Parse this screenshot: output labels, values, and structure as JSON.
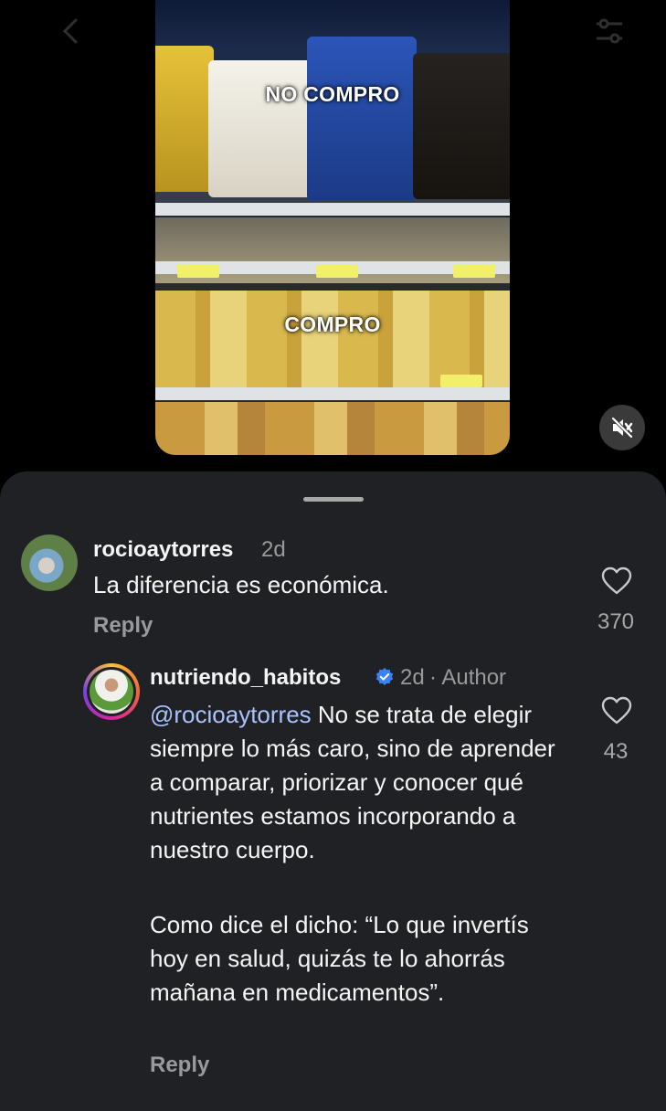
{
  "video": {
    "overlay_top": "NO COMPRO",
    "overlay_bottom": "COMPRO"
  },
  "comments": [
    {
      "username": "rocioaytorres",
      "time": "2d",
      "text": "La diferencia es económica.",
      "reply_label": "Reply",
      "likes": "370"
    },
    {
      "username": "nutriendo_habitos",
      "verified": true,
      "time": "2d",
      "author_tag": "· Author",
      "mention": "@rocioaytorres",
      "text_p1": " No se trata de elegir siempre lo más caro, sino de aprender a comparar, priorizar y conocer qué nutrientes estamos incorporando a nuestro cuerpo.",
      "text_p2": "Como dice el dicho: “Lo que invertís hoy en salud, quizás te lo ahorrás mañana en medicamentos”.",
      "reply_label": "Reply",
      "likes": "43"
    }
  ],
  "icons": {
    "back": "chevron-left-icon",
    "filter": "sliders-icon",
    "mute": "speaker-muted-icon",
    "like": "heart-outline-icon",
    "verified": "verified-badge-icon"
  },
  "colors": {
    "sheet_bg": "#202125",
    "mention": "#a9c3ff",
    "verified": "#3b82f6"
  }
}
